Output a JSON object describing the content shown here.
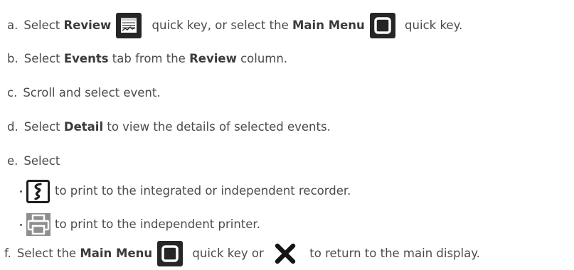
{
  "steps": {
    "a": {
      "letter": "a.",
      "t1": "Select ",
      "b1": "Review",
      "t2": " quick key, or select the ",
      "b2": "Main Menu",
      "t3": " quick key."
    },
    "b": {
      "letter": "b.",
      "t1": "Select ",
      "b1": "Events",
      "t2": " tab from the ",
      "b2": "Review",
      "t3": " column."
    },
    "c": {
      "letter": "c.",
      "t1": "Scroll and select event."
    },
    "d": {
      "letter": "d.",
      "t1": "Select ",
      "b1": "Detail",
      "t2": " to view the details of selected events."
    },
    "e": {
      "letter": "e.",
      "t1": "Select",
      "sub1": "to print to the integrated or independent recorder.",
      "sub2": "to print to the independent printer."
    },
    "f": {
      "letter": "f.",
      "t1": "Select the ",
      "b1": "Main Menu",
      "t2": " quick key or ",
      "t3": " to return to the main display."
    }
  },
  "icons": {
    "review": "review-quick-key-icon",
    "main_menu": "main-menu-quick-key-icon",
    "recorder": "recorder-print-icon",
    "printer": "printer-icon",
    "close": "close-x-icon"
  }
}
